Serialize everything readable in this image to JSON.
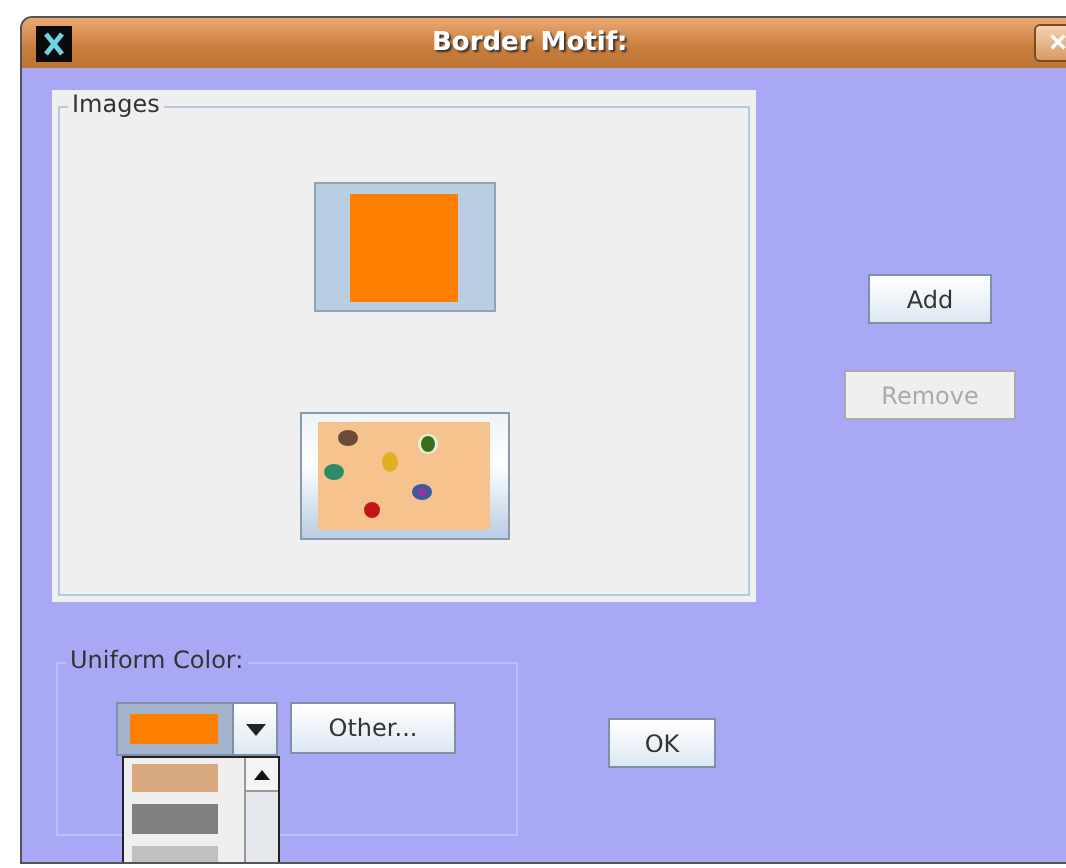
{
  "window": {
    "title": "Border Motif:",
    "close": "×"
  },
  "images": {
    "label": "Images",
    "items": [
      {
        "kind": "color",
        "color": "#ff8000",
        "selected": true
      },
      {
        "kind": "picture",
        "selected": false
      }
    ]
  },
  "side_buttons": [
    {
      "label": "Add",
      "disabled": false
    },
    {
      "label": "Remove",
      "disabled": true
    }
  ],
  "uniform_color": {
    "label": "Uniform Color:",
    "combo": {
      "color": "#ff8000",
      "expanded": true
    },
    "other_button": "Other...",
    "options": [
      {
        "color": "#d8a97f"
      },
      {
        "color": "#808080"
      },
      {
        "color": "#c0c0c0"
      }
    ]
  },
  "ok_button": "OK"
}
